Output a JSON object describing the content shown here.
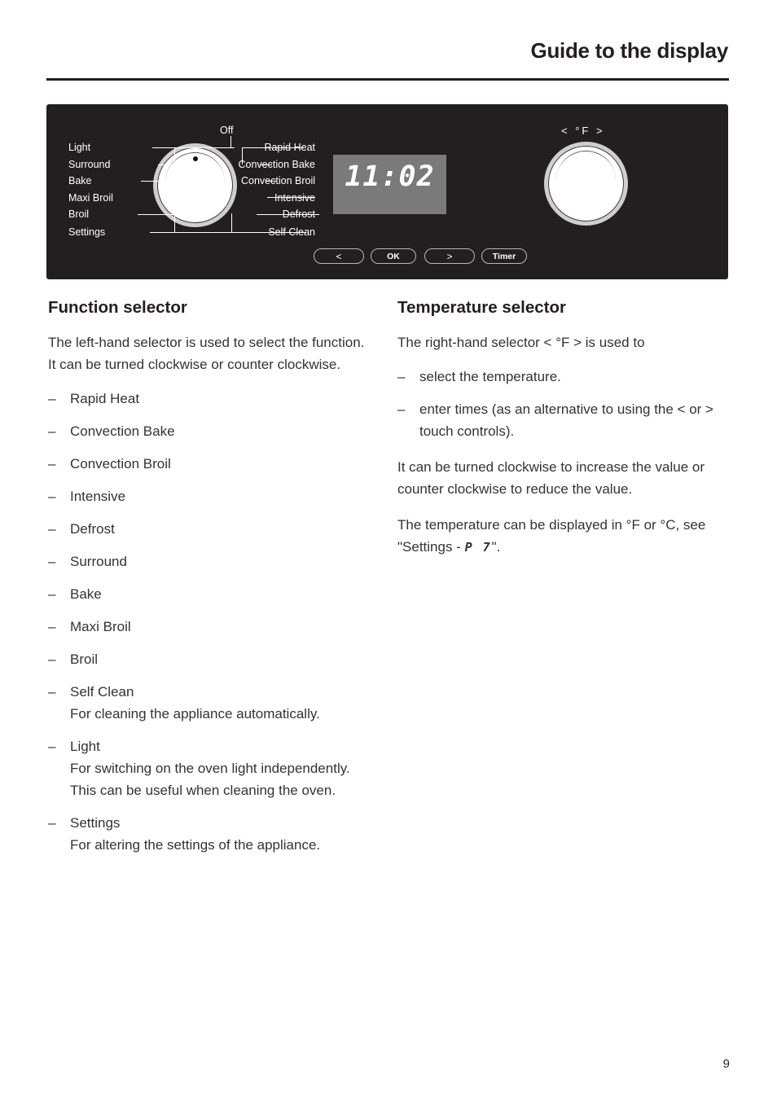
{
  "header": {
    "title": "Guide to the display"
  },
  "panel": {
    "dial_labels_left": [
      {
        "label": "Light"
      },
      {
        "label": "Surround"
      },
      {
        "label": "Bake"
      },
      {
        "label": "Maxi Broil"
      },
      {
        "label": "Broil"
      },
      {
        "label": "Settings"
      }
    ],
    "dial_label_top": "Off",
    "dial_labels_right": [
      {
        "label": "Rapid Heat"
      },
      {
        "label": "Convection Bake"
      },
      {
        "label": "Convection Broil"
      },
      {
        "label": "Intensive"
      },
      {
        "label": "Defrost"
      },
      {
        "label": "Self Clean"
      }
    ],
    "display_value": "11:02",
    "temp_caption": "< °F >",
    "buttons": [
      {
        "label": "<",
        "name": "left-arrow"
      },
      {
        "label": "OK",
        "name": "ok"
      },
      {
        "label": ">",
        "name": "right-arrow"
      },
      {
        "label": "Timer",
        "name": "timer"
      }
    ],
    "panel_color": "#231f20",
    "display_color": "#7a7a7a",
    "knob_face_color": "#ffffff",
    "knob_ring_color": "#cfcfcf"
  },
  "function_selector": {
    "heading": "Function selector",
    "intro": "The left-hand selector is used to select the function.\nIt can be turned clockwise or counter clockwise.",
    "items": [
      {
        "label": "Rapid Heat",
        "detail": ""
      },
      {
        "label": "Convection Bake",
        "detail": ""
      },
      {
        "label": "Convection Broil",
        "detail": ""
      },
      {
        "label": "Intensive",
        "detail": ""
      },
      {
        "label": "Defrost",
        "detail": ""
      },
      {
        "label": "Surround",
        "detail": ""
      },
      {
        "label": "Bake",
        "detail": ""
      },
      {
        "label": "Maxi Broil",
        "detail": ""
      },
      {
        "label": "Broil",
        "detail": ""
      },
      {
        "label": "Self Clean",
        "detail": "For cleaning the appliance automatically."
      },
      {
        "label": "Light",
        "detail": "For switching on the oven light independently. This can be useful when cleaning the oven."
      },
      {
        "label": "Settings",
        "detail": "For altering the settings of the appliance."
      }
    ],
    "dash": "–"
  },
  "temperature_selector": {
    "heading": "Temperature selector",
    "intro_a": "The right-hand selector ",
    "intro_symbol": "< °F >",
    "intro_b": " is used to",
    "items": [
      {
        "text": "select the temperature."
      },
      {
        "text": "enter times (as an alternative to using the < or > touch controls)."
      }
    ],
    "para_turn": "It can be turned clockwise to increase the value or counter clockwise to reduce the value.",
    "para_units_a": "The temperature can be displayed in °F or °C, see \"Settings - ",
    "para_units_code": "P 7",
    "para_units_b": "\".",
    "dash": "–"
  },
  "footer": {
    "page_number": "9"
  }
}
